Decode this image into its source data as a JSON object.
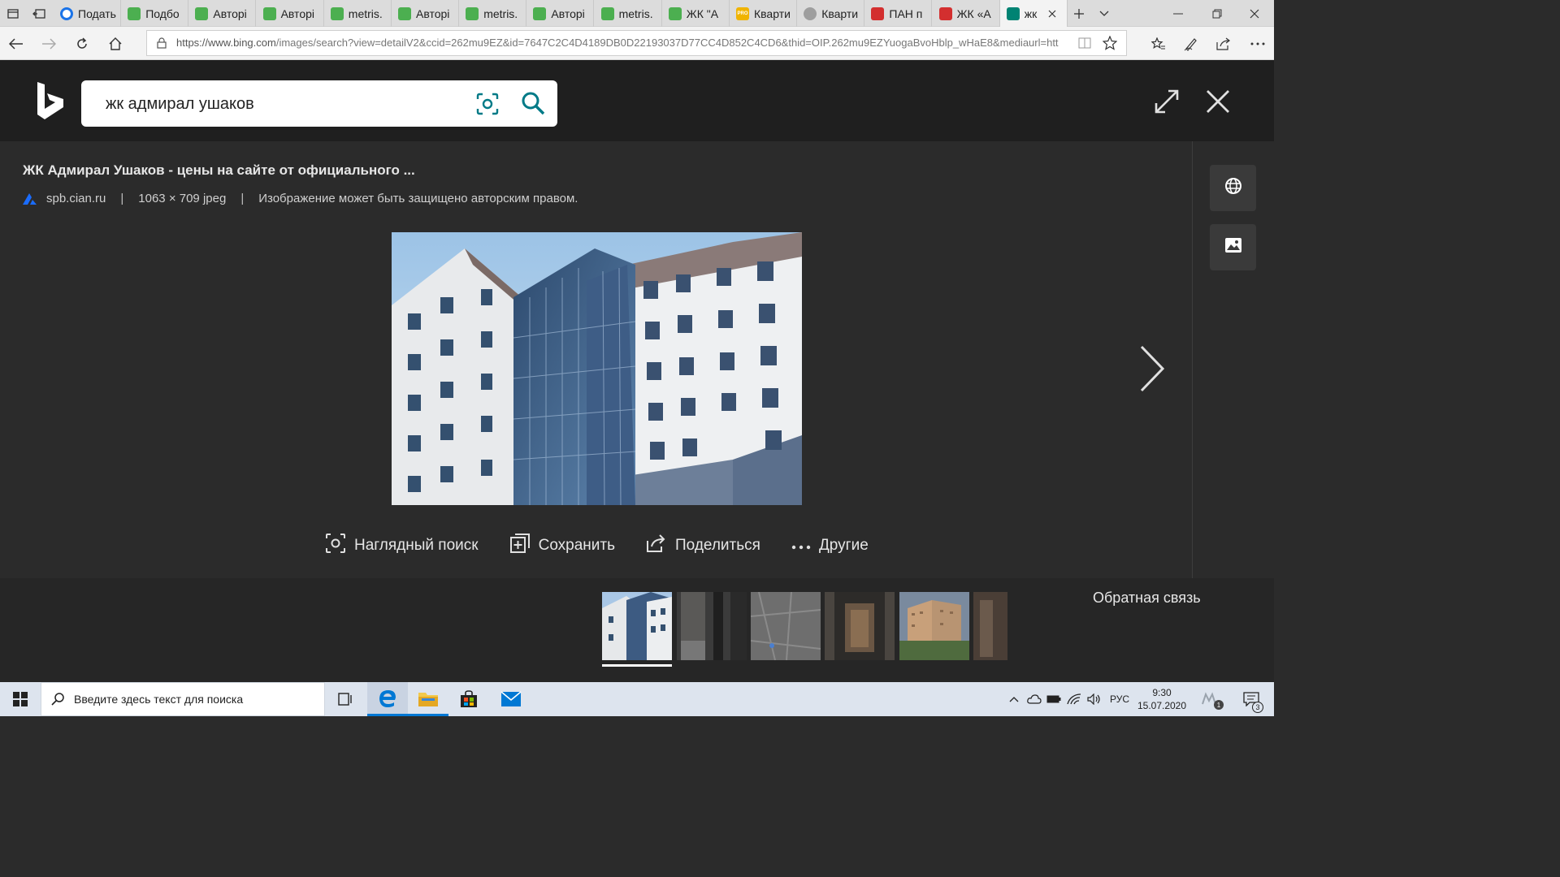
{
  "browser": {
    "tabs": [
      {
        "label": "Подать",
        "favicon": "circle-blue-icon"
      },
      {
        "label": "Подбо",
        "favicon": "green-leaf-icon"
      },
      {
        "label": "Авторі",
        "favicon": "green-leaf-icon"
      },
      {
        "label": "Авторі",
        "favicon": "green-leaf-icon"
      },
      {
        "label": "metris.",
        "favicon": "green-leaf-icon"
      },
      {
        "label": "Авторі",
        "favicon": "green-leaf-icon"
      },
      {
        "label": "metris.",
        "favicon": "green-leaf-icon"
      },
      {
        "label": "Авторі",
        "favicon": "green-leaf-icon"
      },
      {
        "label": "metris.",
        "favicon": "green-leaf-icon"
      },
      {
        "label": "ЖК \"А",
        "favicon": "green-leaf-icon"
      },
      {
        "label": "Кварти",
        "favicon": "pro-badge-icon"
      },
      {
        "label": "Кварти",
        "favicon": "round-gray-icon"
      },
      {
        "label": "ПАН п",
        "favicon": "red-square-icon"
      },
      {
        "label": "ЖК «А",
        "favicon": "red-square-icon"
      },
      {
        "label": "жк",
        "favicon": "bing-icon"
      }
    ],
    "url_host": "https://www.bing.com",
    "url_rest": "/images/search?view=detailV2&ccid=262mu9EZ&id=7647C2C4D4189DB0D22193037D77CC4D852C4CD6&thid=OIP.262mu9EZYuogaBvoHblp_wHaE8&mediaurl=htt"
  },
  "search": {
    "query": "жк адмирал ушаков"
  },
  "detail": {
    "title": "ЖК Адмирал Ушаков - цены на сайте от официального ...",
    "source": "spb.cian.ru",
    "dimensions": "1063 × 709 jpeg",
    "copyright": "Изображение может быть защищено авторским правом."
  },
  "actions": {
    "visual_search": "Наглядный поиск",
    "save": "Сохранить",
    "share": "Поделиться",
    "more": "Другие"
  },
  "feedback": "Обратная связь",
  "taskbar": {
    "search_placeholder": "Введите здесь текст для поиска",
    "language": "РУС",
    "time": "9:30",
    "date": "15.07.2020",
    "notification_count": "3",
    "tray_badge": "1"
  },
  "colors": {
    "accent": "#0078d4",
    "bing_teal": "#008373",
    "dark_bg": "#2b2b2b",
    "header_bg": "#1f1f1f"
  }
}
